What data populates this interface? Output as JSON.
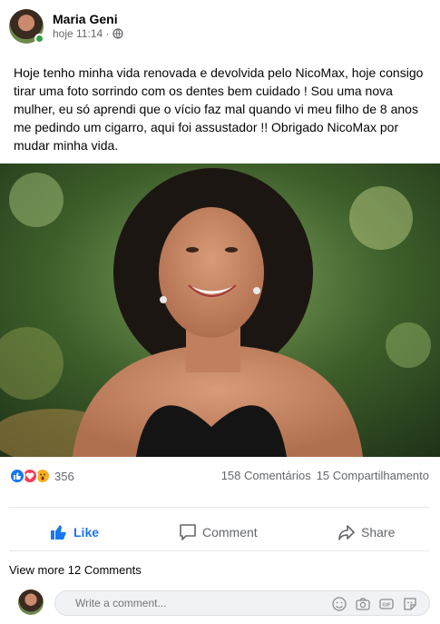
{
  "post": {
    "author": "Maria Geni",
    "time": "hoje 11:14 ·",
    "text": "Hoje tenho minha vida renovada e devolvida pelo NicoMax, hoje consigo tirar uma foto sorrindo com os dentes bem cuidado ! Sou uma nova mulher, eu só aprendi que o vício faz mal quando vi meu filho de 8 anos me pedindo um cigarro, aqui foi assustador !! Obrigado NicoMax por mudar minha vida."
  },
  "reactions": {
    "count": "356",
    "comments": "158 Comentários",
    "shares": "15 Compartilhamento",
    "icons": [
      "like-icon",
      "love-icon",
      "wow-icon"
    ]
  },
  "actions": {
    "like": "Like",
    "comment": "Comment",
    "share": "Share"
  },
  "comments": {
    "view_more": "View more 12 Comments",
    "placeholder": "Write a comment..."
  },
  "colors": {
    "accent": "#1877f2",
    "muted": "#65676b",
    "online": "#31a24c"
  }
}
